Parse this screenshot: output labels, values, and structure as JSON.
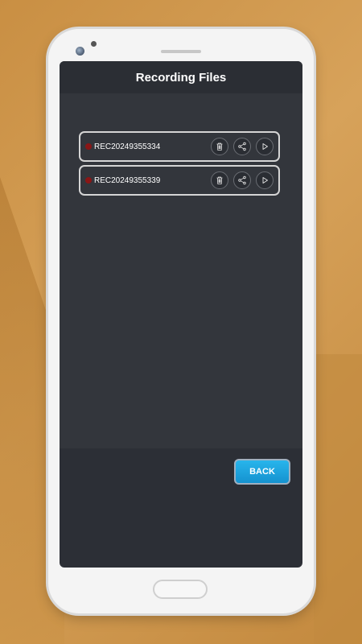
{
  "screen": {
    "title": "Recording Files"
  },
  "files": [
    {
      "name": "REC20249355334"
    },
    {
      "name": "REC20249355339"
    }
  ],
  "actions": {
    "back_label": "BACK"
  },
  "icons": [
    "delete-icon",
    "share-icon",
    "play-icon"
  ],
  "colors": {
    "screen_bg": "#2c2f36",
    "list_bg": "#33363c",
    "record_dot": "#8a1616",
    "back_button": "#1ea5e0"
  }
}
